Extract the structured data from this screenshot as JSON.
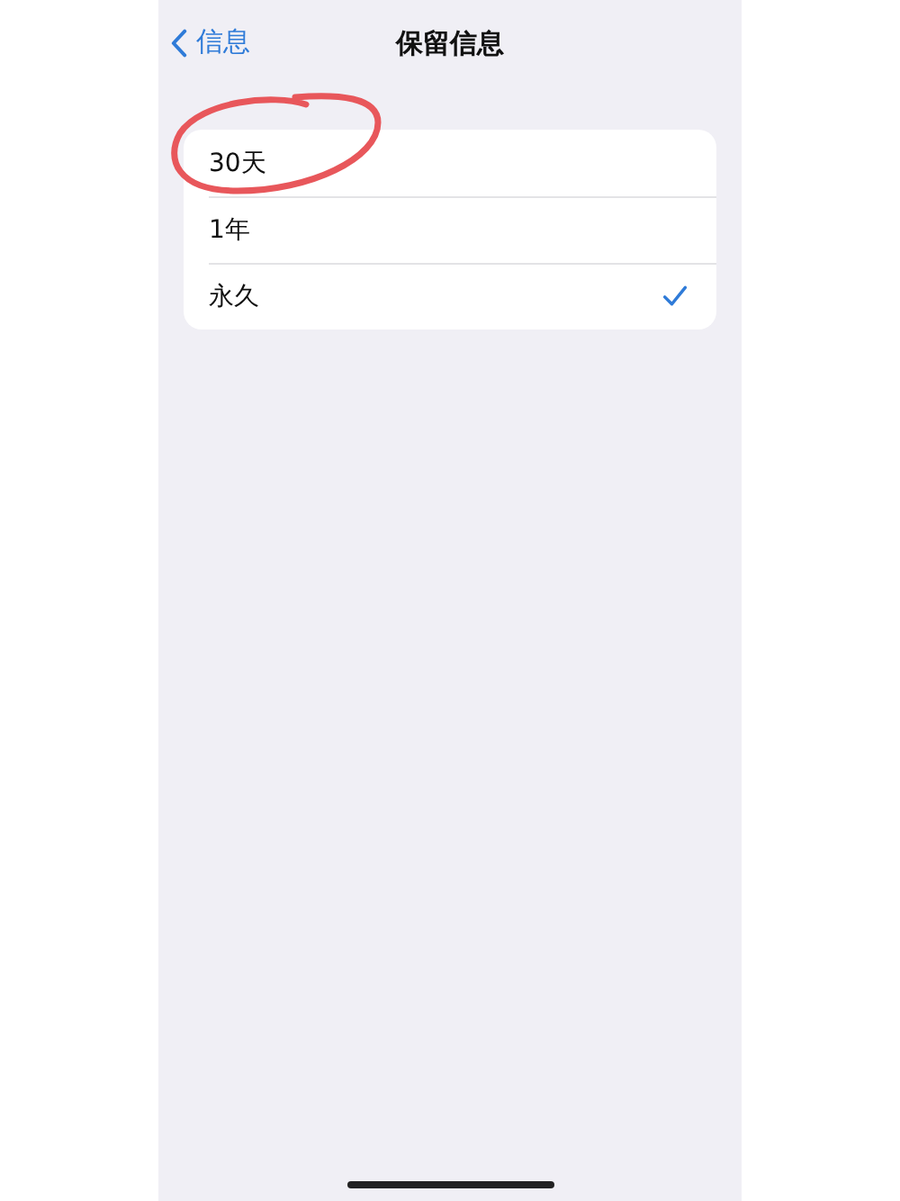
{
  "nav_bar": {
    "back_label": "信息",
    "title": "保留信息"
  },
  "options": [
    {
      "label": "30天",
      "selected": false,
      "circled": true
    },
    {
      "label": "1年",
      "selected": false,
      "circled": false
    },
    {
      "label": "永久",
      "selected": true,
      "circled": false
    }
  ]
}
